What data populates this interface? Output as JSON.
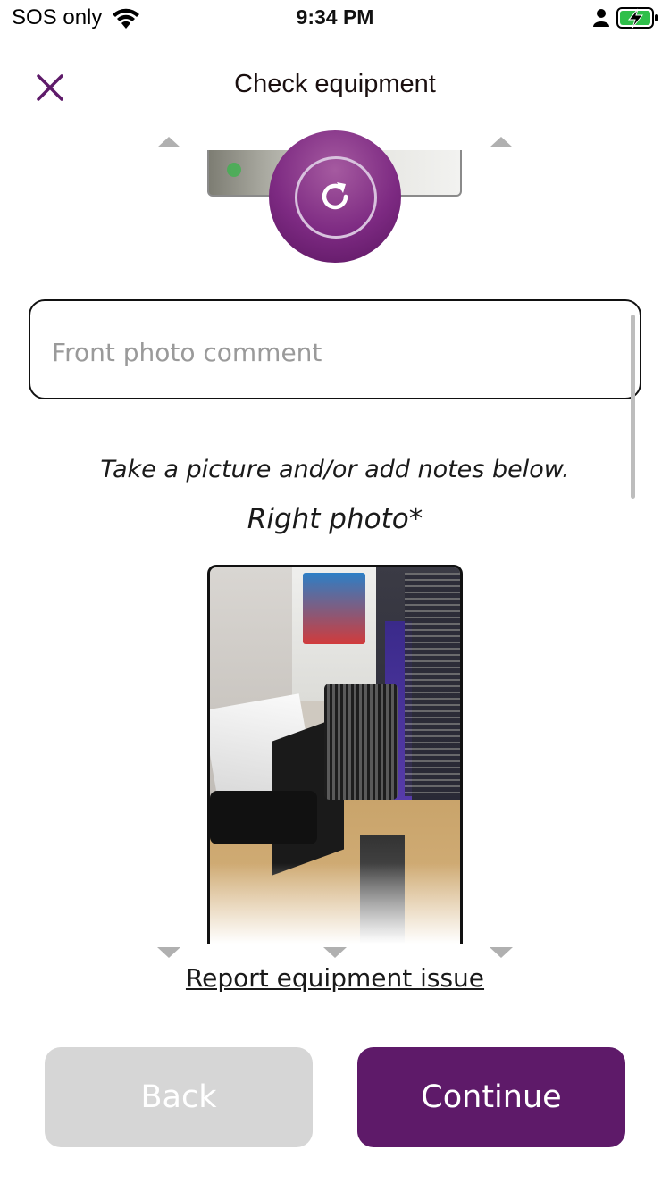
{
  "status_bar": {
    "carrier": "SOS only",
    "time": "9:34 PM",
    "icons": [
      "wifi-icon",
      "person-icon",
      "battery-charging-icon"
    ],
    "battery_color": "#2fbf4a"
  },
  "header": {
    "title": "Check equipment",
    "close_icon": "close-icon",
    "accent": "#5e1a69"
  },
  "front_photo": {
    "retake_icon": "refresh-icon",
    "comment_placeholder": "Front photo comment",
    "comment_value": ""
  },
  "instructions": "Take a picture and/or add notes below.",
  "right_photo": {
    "label": "Right photo*"
  },
  "links": {
    "report_issue": "Report equipment issue"
  },
  "footer": {
    "back_label": "Back",
    "continue_label": "Continue",
    "back_color": "#d6d6d6",
    "continue_color": "#5e1a69"
  }
}
